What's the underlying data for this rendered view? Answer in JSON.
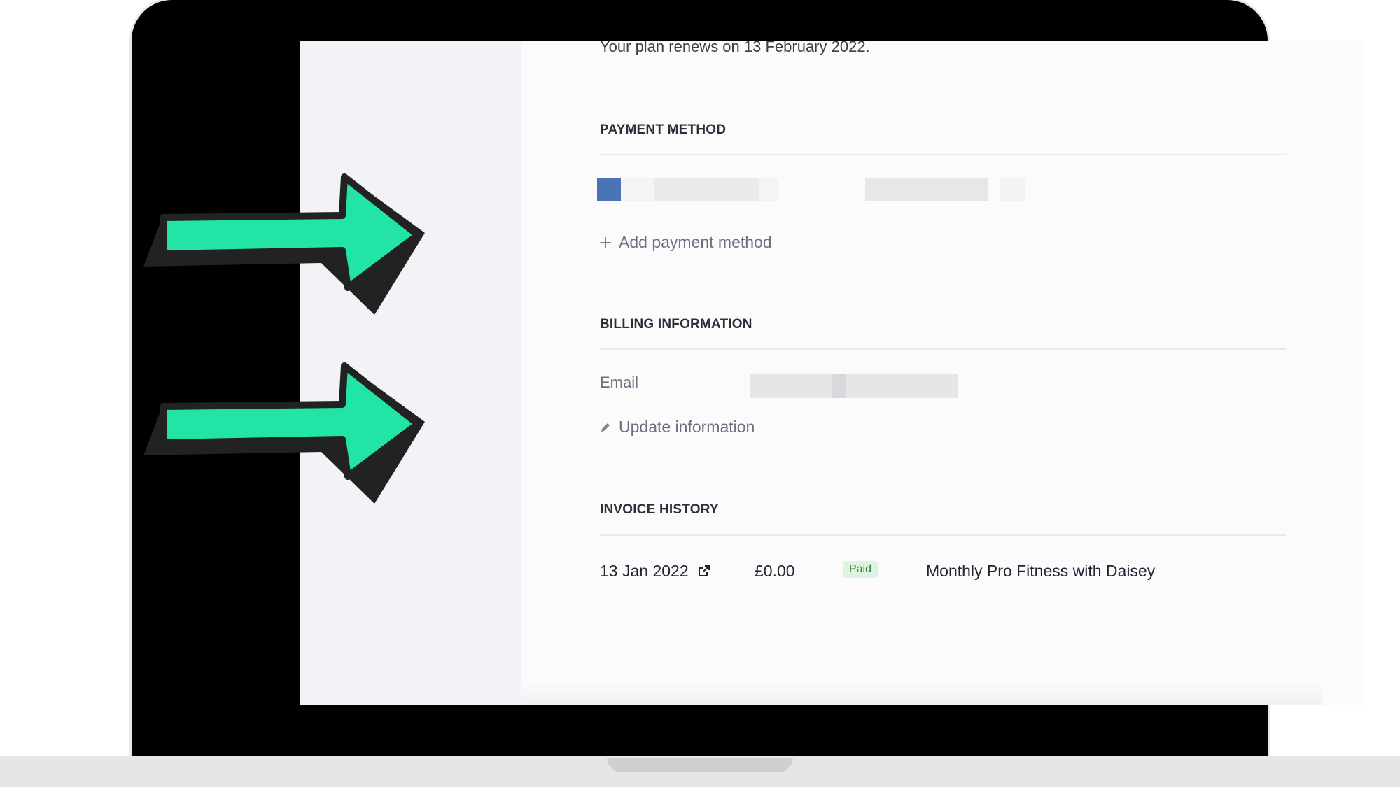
{
  "plan": {
    "renews_text": "Your plan renews on 13 February 2022."
  },
  "payment_method": {
    "title": "PAYMENT METHOD",
    "add_label": "Add payment method"
  },
  "billing": {
    "title": "BILLING INFORMATION",
    "email_label": "Email",
    "update_label": "Update information"
  },
  "invoices": {
    "title": "INVOICE HISTORY",
    "rows": [
      {
        "date": "13 Jan 2022",
        "amount": "£0.00",
        "status": "Paid",
        "description": "Monthly Pro Fitness with Daisey"
      }
    ]
  },
  "icons": {
    "add": "plus-icon",
    "edit": "pencil-icon",
    "external": "external-link-icon",
    "callout": "arrow-pointer-icon"
  },
  "colors": {
    "arrow_fill": "#22e4a6",
    "paid_badge_bg": "#dff3e1",
    "paid_badge_text": "#2f7f43",
    "card_brand_blurred": "#4a73b8"
  }
}
